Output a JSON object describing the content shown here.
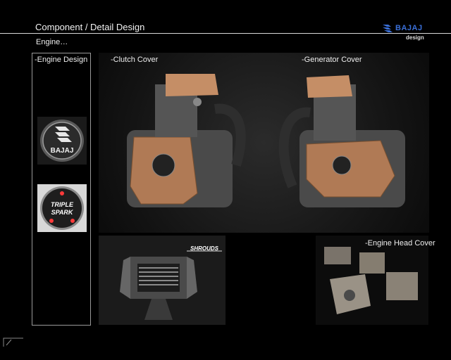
{
  "header": {
    "title": "Component / Detail Design",
    "subtitle": "Engine…",
    "brand_name": "BAJAJ",
    "brand_sub": "design"
  },
  "sidebar": {
    "label": "-Engine Design",
    "badge_bajaj_text": "BAJAJ",
    "badge_triple_line1": "TRIPLE",
    "badge_triple_line2": "SPARK"
  },
  "main": {
    "clutch_label": "-Clutch Cover",
    "generator_label": "-Generator Cover",
    "shroud_label": "SHROUDS",
    "head_label": "-Engine Head Cover"
  },
  "colors": {
    "background": "#000000",
    "brand_blue": "#3a6fd8",
    "copper": "#b07a55",
    "engine_grey": "#4a4a4a"
  },
  "icons": [
    "bajaj-logo-icon",
    "corner-mark-icon"
  ]
}
